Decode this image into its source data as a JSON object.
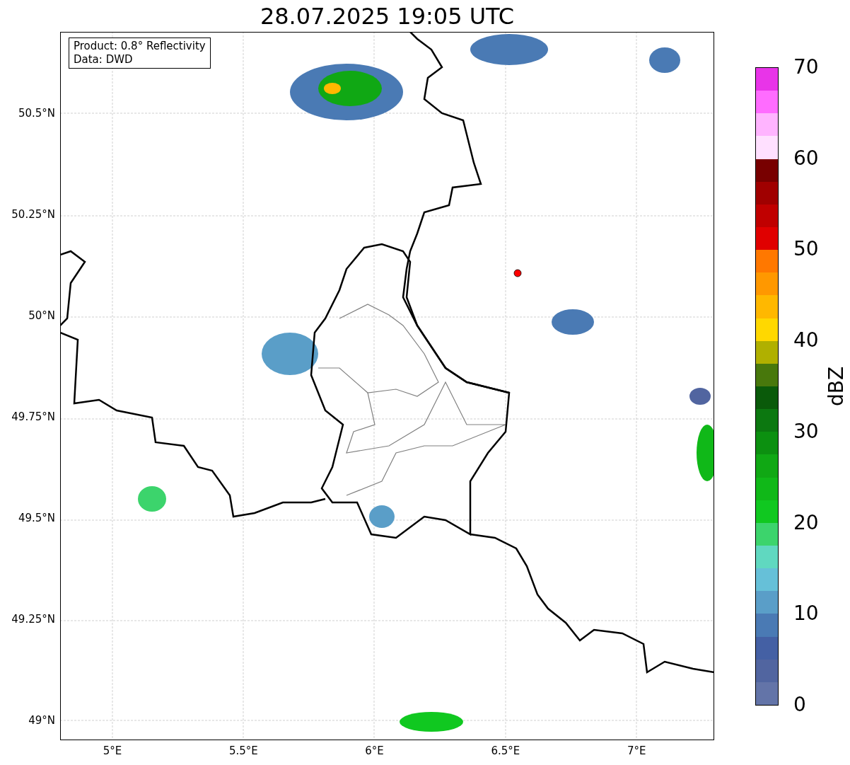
{
  "title": "28.07.2025 19:05 UTC",
  "info_box": [
    "Product: 0.8° Reflectivity",
    "Data: DWD"
  ],
  "y_ticks": [
    "50.5°N",
    "50.25°N",
    "50°N",
    "49.75°N",
    "49.5°N",
    "49.25°N",
    "49°N"
  ],
  "x_ticks": [
    "5°E",
    "5.5°E",
    "6°E",
    "6.5°E",
    "7°E"
  ],
  "colorbar": {
    "label": "dBZ",
    "ticks": [
      "70",
      "60",
      "50",
      "40",
      "30",
      "20",
      "10",
      "0"
    ],
    "bands": [
      {
        "color": "#6374a8"
      },
      {
        "color": "#5165a0"
      },
      {
        "color": "#4460a4"
      },
      {
        "color": "#4a7ab4"
      },
      {
        "color": "#5a9ec8"
      },
      {
        "color": "#66c0d8"
      },
      {
        "color": "#60d8c0"
      },
      {
        "color": "#3cd46c"
      },
      {
        "color": "#10c820"
      },
      {
        "color": "#10b818"
      },
      {
        "color": "#10a814"
      },
      {
        "color": "#0c9010"
      },
      {
        "color": "#0c7810"
      },
      {
        "color": "#0a5a0a"
      },
      {
        "color": "#48780c"
      },
      {
        "color": "#b0b000"
      },
      {
        "color": "#ffd800"
      },
      {
        "color": "#ffb800"
      },
      {
        "color": "#ff9800"
      },
      {
        "color": "#ff7800"
      },
      {
        "color": "#e00000"
      },
      {
        "color": "#c00000"
      },
      {
        "color": "#a00000"
      },
      {
        "color": "#780000"
      },
      {
        "color": "#ffe0ff"
      },
      {
        "color": "#ffb4ff"
      },
      {
        "color": "#ff6cff"
      },
      {
        "color": "#e834e8"
      }
    ]
  }
}
